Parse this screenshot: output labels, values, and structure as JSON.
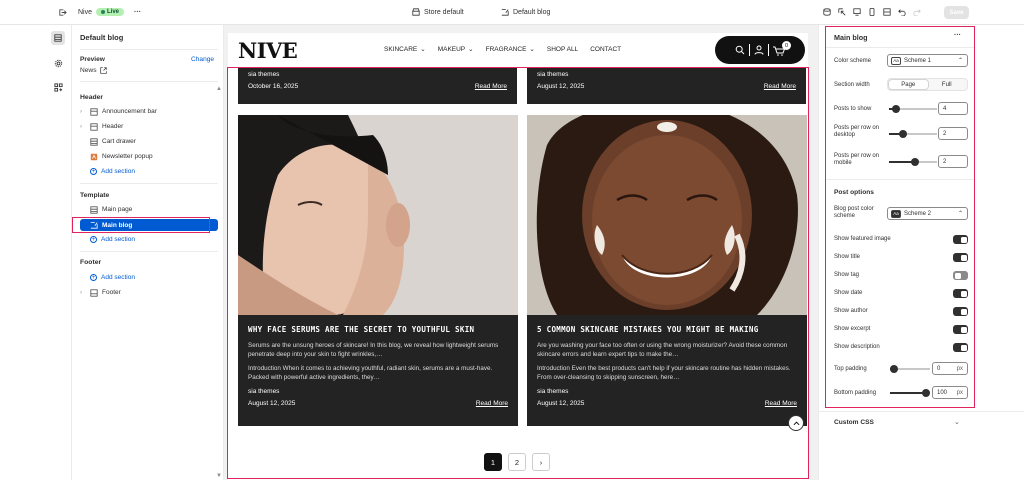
{
  "topbar": {
    "theme_name": "Nive",
    "live_label": "Live",
    "more_label": "···",
    "store_label": "Store default",
    "blog_label": "Default blog",
    "save_label": "Save"
  },
  "sidebar": {
    "title": "Default blog",
    "preview_label": "Preview",
    "change_label": "Change",
    "preview_value": "News",
    "header_group": "Header",
    "header_items": [
      {
        "label": "Announcement bar"
      },
      {
        "label": "Header"
      },
      {
        "label": "Cart drawer"
      },
      {
        "label": "Newsletter popup"
      }
    ],
    "add_section": "Add section",
    "template_group": "Template",
    "template_items": [
      {
        "label": "Main page"
      },
      {
        "label": "Main blog"
      }
    ],
    "footer_group": "Footer",
    "footer_items": [
      {
        "label": "Footer"
      }
    ]
  },
  "store": {
    "logo": "NIVE",
    "nav": [
      "SKINCARE",
      "MAKEUP",
      "FRAGRANCE",
      "SHOP ALL",
      "CONTACT"
    ],
    "cart_count": "0",
    "top_posts": [
      {
        "author": "sia themes",
        "date": "October 16, 2025",
        "read_more": "Read More"
      },
      {
        "author": "sia themes",
        "date": "August 12, 2025",
        "read_more": "Read More"
      }
    ],
    "posts": [
      {
        "title": "WHY FACE SERUMS ARE THE SECRET TO YOUTHFUL SKIN",
        "excerpt": "Serums are the unsung heroes of skincare! In this blog, we reveal how lightweight serums penetrate deep into your skin to fight wrinkles,…",
        "description": "Introduction When it comes to achieving youthful, radiant skin, serums are a must-have. Packed with powerful active ingredients, they…",
        "author": "sia themes",
        "date": "August 12, 2025",
        "read_more": "Read More"
      },
      {
        "title": "5 COMMON SKINCARE MISTAKES YOU MIGHT BE MAKING",
        "excerpt": "Are you washing your face too often or using the wrong moisturizer? Avoid these common skincare errors and learn expert tips to make the…",
        "description": "Introduction Even the best products can't help if your skincare routine has hidden mistakes. From over-cleansing to skipping sunscreen, here…",
        "author": "sia themes",
        "date": "August 12, 2025",
        "read_more": "Read More"
      }
    ],
    "pages": [
      "1",
      "2"
    ],
    "next_label": "›"
  },
  "panel": {
    "title": "Main blog",
    "more": "···",
    "color_scheme_label": "Color scheme",
    "color_scheme_value": "Scheme 1",
    "section_width_label": "Section width",
    "width_options": [
      "Page",
      "Full"
    ],
    "width_selected": "Page",
    "posts_to_show_label": "Posts to show",
    "posts_to_show": "4",
    "posts_to_show_fraction": 0.08,
    "posts_desktop_label": "Posts per row on desktop",
    "posts_desktop": "2",
    "posts_desktop_fraction": 0.25,
    "posts_mobile_label": "Posts per row on mobile",
    "posts_mobile": "2",
    "posts_mobile_fraction": 0.55,
    "post_options_label": "Post options",
    "blog_post_scheme_label": "Blog post color scheme",
    "blog_post_scheme_value": "Scheme 2",
    "toggles": [
      {
        "label": "Show featured image",
        "on": true
      },
      {
        "label": "Show title",
        "on": true
      },
      {
        "label": "Show tag",
        "on": false
      },
      {
        "label": "Show date",
        "on": true
      },
      {
        "label": "Show author",
        "on": true
      },
      {
        "label": "Show excerpt",
        "on": true
      },
      {
        "label": "Show description",
        "on": true
      }
    ],
    "top_padding_label": "Top padding",
    "top_padding": "0",
    "top_padding_fraction": 0,
    "bottom_padding_label": "Bottom padding",
    "bottom_padding": "100",
    "bottom_padding_fraction": 1,
    "unit": "px",
    "custom_css_label": "Custom CSS"
  },
  "colors": {
    "accent": "#005bd3",
    "highlight": "#e0245e",
    "dark_card": "#232323"
  }
}
